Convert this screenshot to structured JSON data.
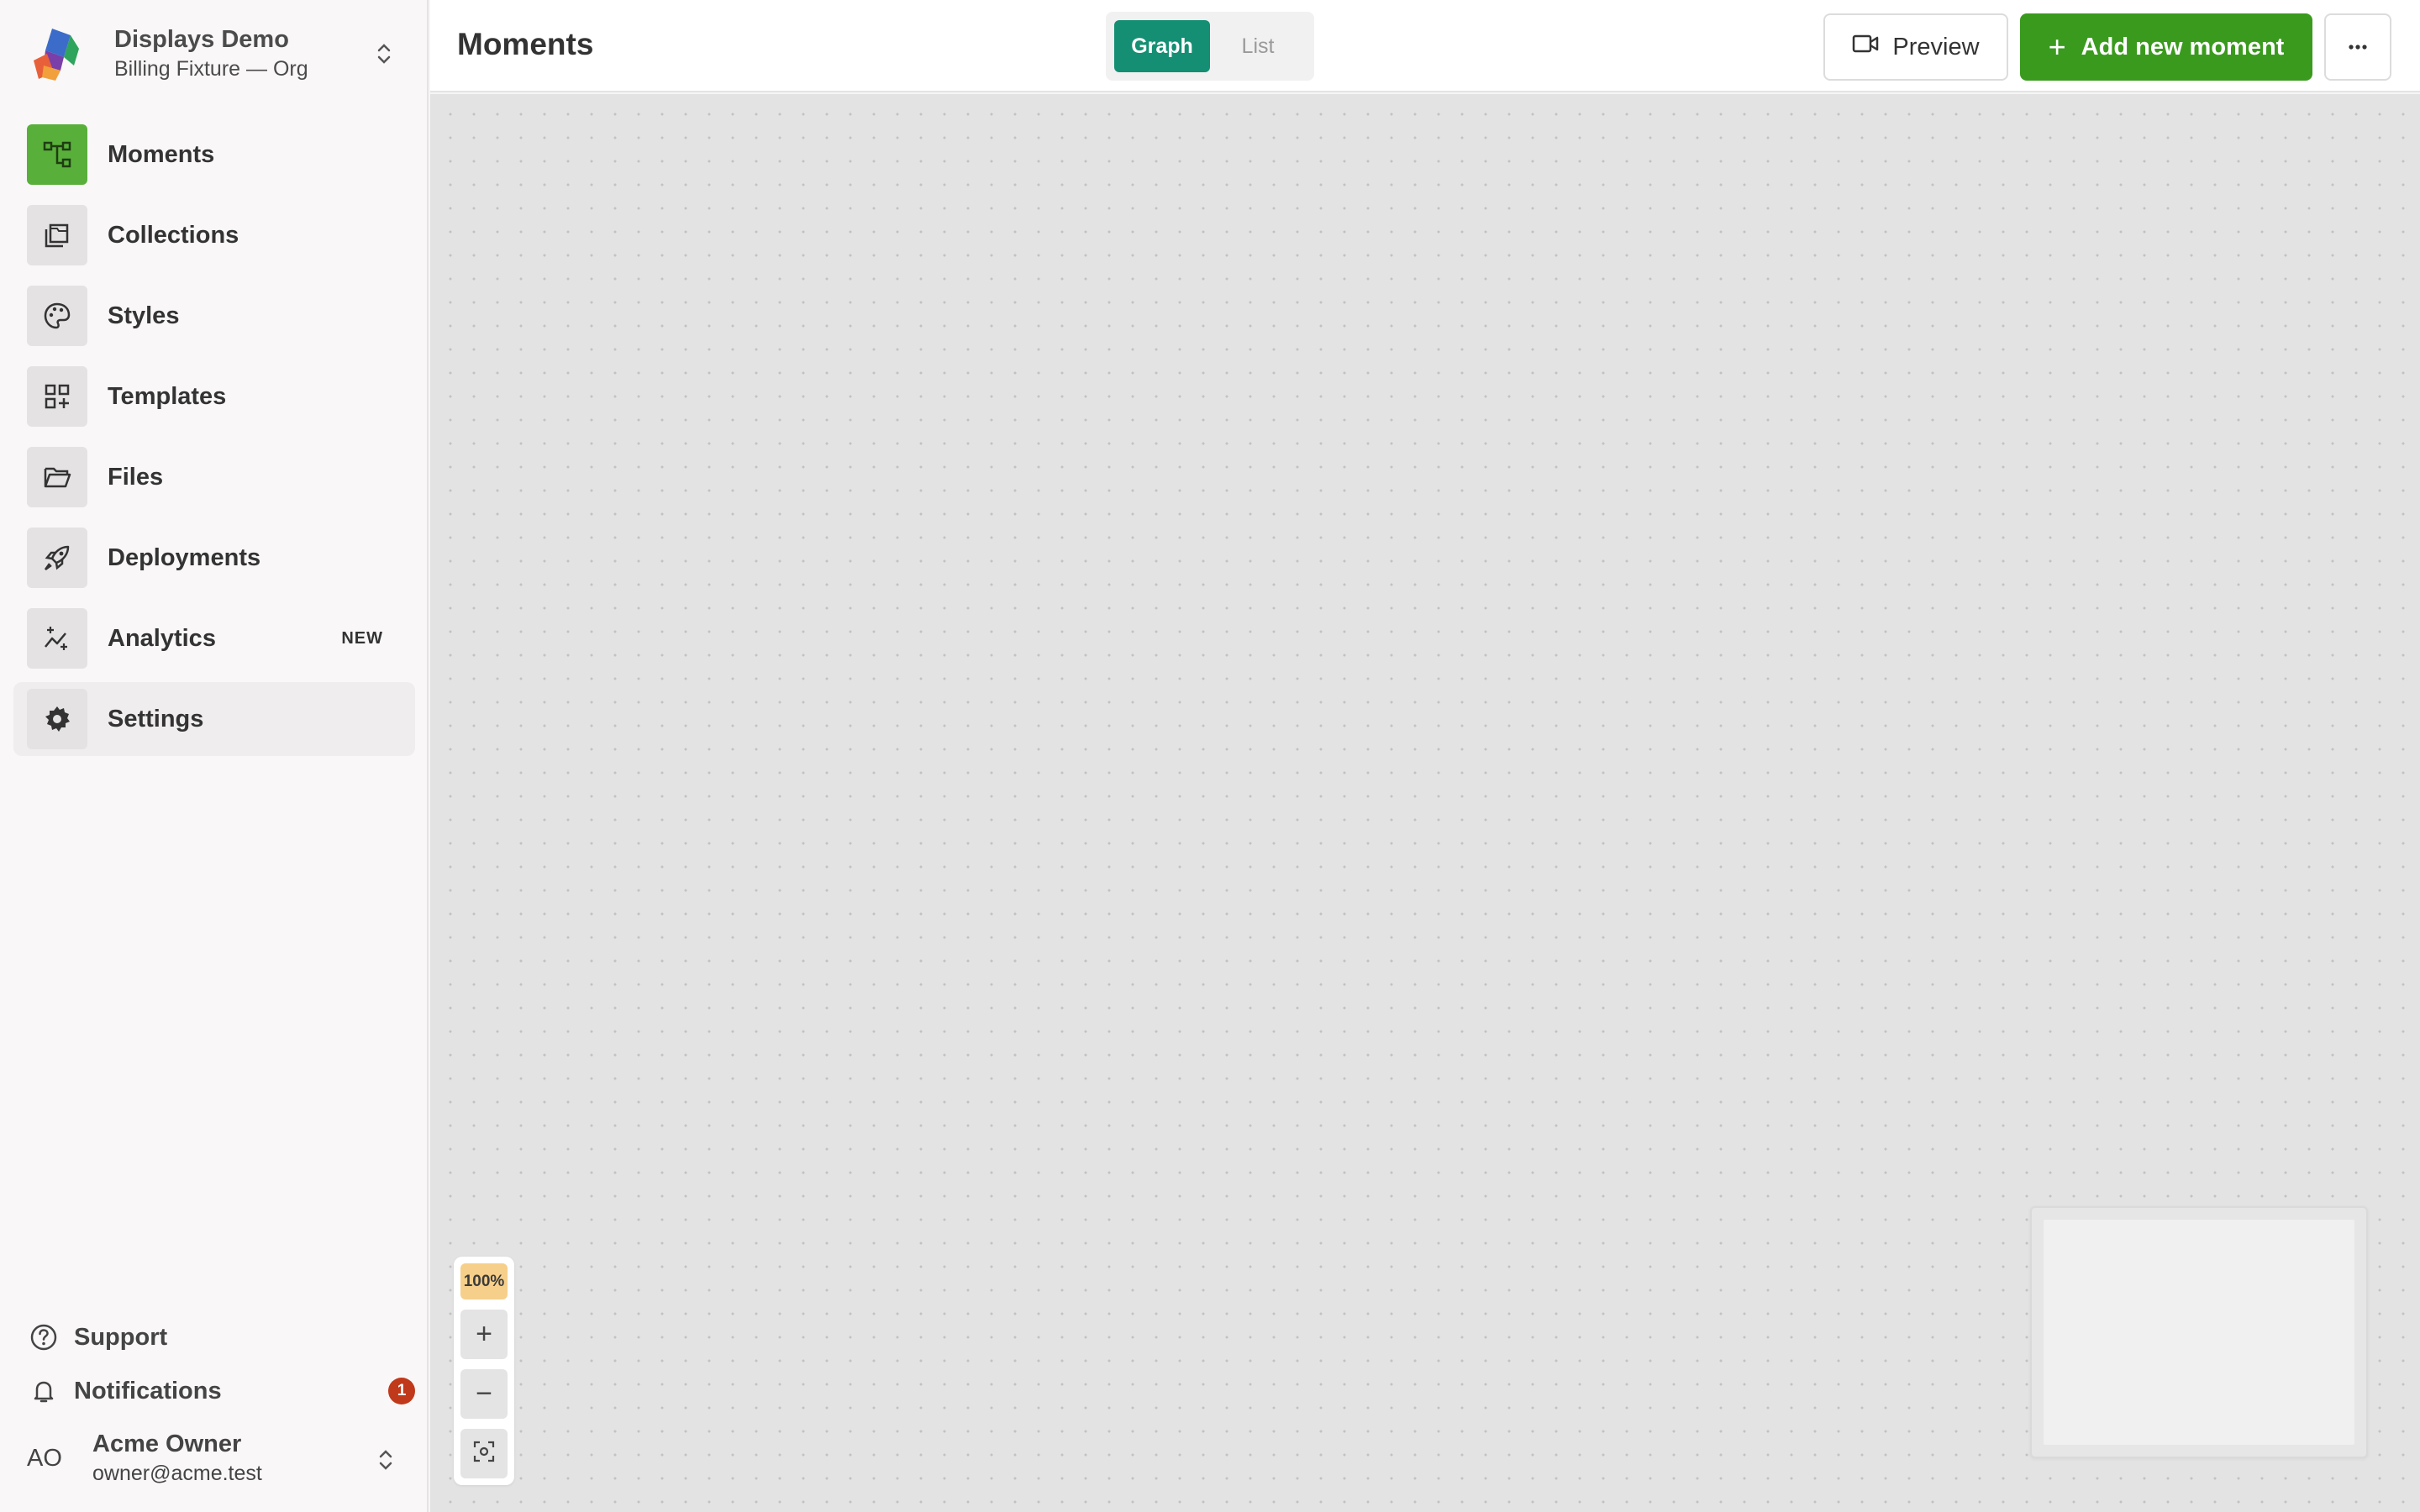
{
  "org": {
    "name": "Displays Demo",
    "subtitle": "Billing Fixture — Org"
  },
  "sidebar": {
    "items": [
      {
        "label": "Moments",
        "icon": "moments-graph-icon",
        "active": true
      },
      {
        "label": "Collections",
        "icon": "collections-icon"
      },
      {
        "label": "Styles",
        "icon": "palette-icon"
      },
      {
        "label": "Templates",
        "icon": "templates-grid-icon"
      },
      {
        "label": "Files",
        "icon": "folder-open-icon"
      },
      {
        "label": "Deployments",
        "icon": "rocket-icon"
      },
      {
        "label": "Analytics",
        "icon": "analytics-sparkle-icon",
        "badge": "NEW"
      },
      {
        "label": "Settings",
        "icon": "gear-icon",
        "hovered": true
      }
    ],
    "support_label": "Support",
    "notifications_label": "Notifications",
    "notifications_count": "1"
  },
  "user": {
    "initials": "AO",
    "name": "Acme Owner",
    "email": "owner@acme.test"
  },
  "header": {
    "title": "Moments",
    "view_toggle": {
      "graph": "Graph",
      "list": "List",
      "selected": "Graph"
    },
    "preview_label": "Preview",
    "add_label": "Add new moment",
    "add_icon": "+",
    "more_icon": "ellipsis-icon"
  },
  "canvas": {
    "zoom_level": "100%",
    "zoom_in": "+",
    "zoom_out": "−"
  },
  "colors": {
    "accent_green": "#3a9a1e",
    "toggle_active": "#148f73",
    "moments_icon_bg": "#58b03a",
    "badge_red": "#c0391a",
    "zoom_badge": "#f6cf8a"
  }
}
